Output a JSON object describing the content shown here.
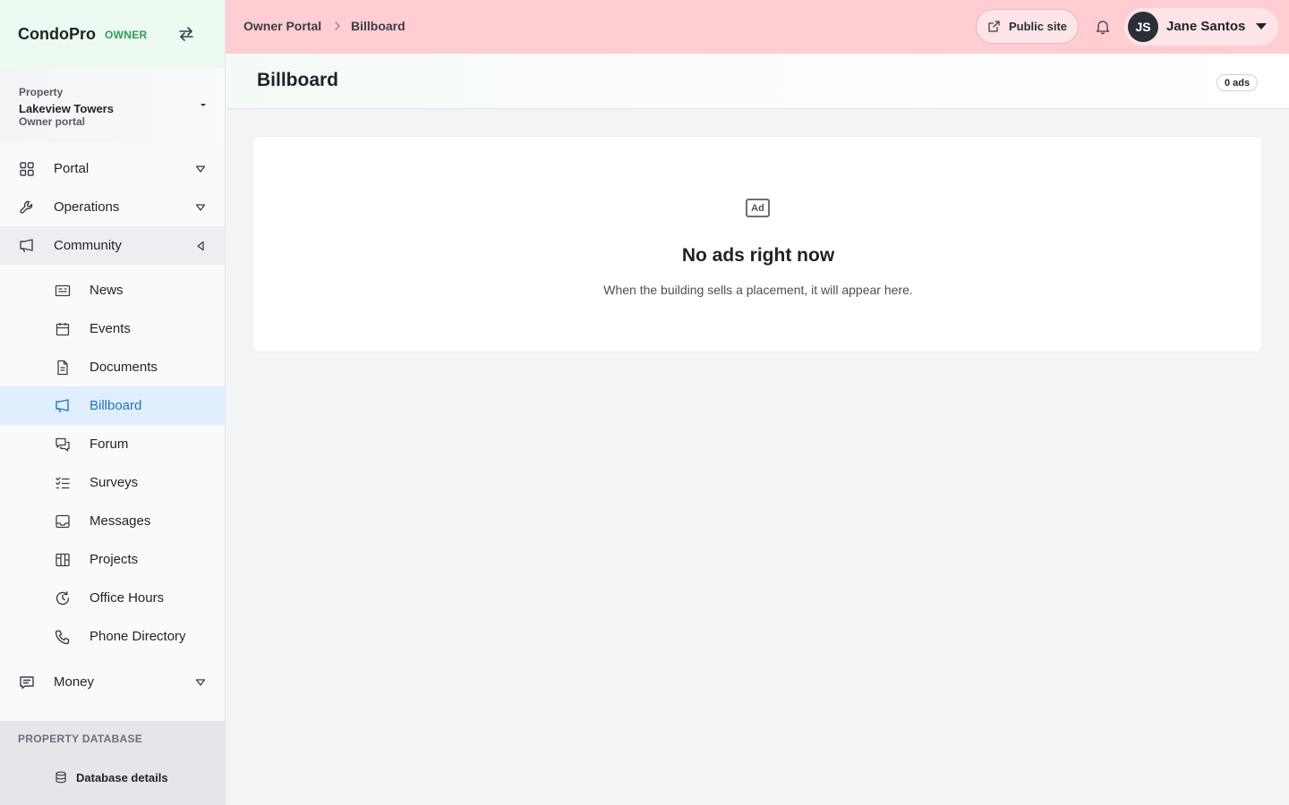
{
  "brand": {
    "name": "CondoPro",
    "role": "OWNER"
  },
  "property": {
    "label": "Property",
    "name": "Lakeview Towers",
    "sub": "Owner portal"
  },
  "nav": {
    "portal": "Portal",
    "operations": "Operations",
    "community": "Community",
    "money": "Money"
  },
  "community_items": [
    "News",
    "Events",
    "Documents",
    "Billboard",
    "Forum",
    "Surveys",
    "Messages",
    "Projects",
    "Office Hours",
    "Phone Directory"
  ],
  "active_item": "Billboard",
  "database": {
    "title": "PROPERTY DATABASE",
    "item": "Database details"
  },
  "breadcrumb": {
    "root": "Owner Portal",
    "current": "Billboard"
  },
  "header": {
    "public_site": "Public site",
    "user_initials": "JS",
    "user_name": "Jane Santos"
  },
  "page": {
    "title": "Billboard",
    "count": "0 ads"
  },
  "empty": {
    "icon_text": "Ad",
    "title": "No ads right now",
    "subtitle": "When the building sells a placement, it will appear here."
  },
  "colors": {
    "accent": "#1a73d1",
    "topbar": "#ffcdd2",
    "brand_role": "#2a9d5c"
  }
}
